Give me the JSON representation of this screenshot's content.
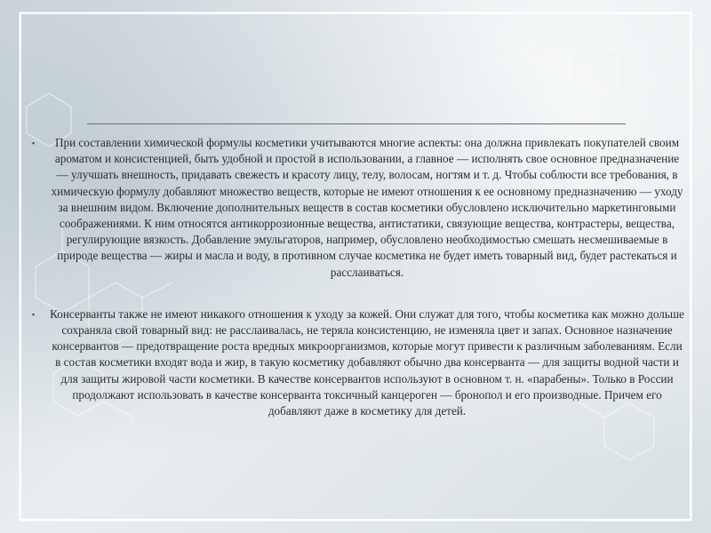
{
  "slide": {
    "bullet_glyph": "▪",
    "paragraphs": [
      "При составлении химической формулы косметики учитываются многие аспекты: она должна привлекать покупателей своим ароматом и консистенцией, быть удобной и простой в использовании, а главное — исполнять свое основное предназначение — улучшать внешность, придавать свежесть и красоту лицу, телу, волосам, ногтям и т. д. Чтобы соблюсти все требования, в химическую формулу добавляют множество веществ, которые не имеют отношения к ее основному предназначению — уходу за внешним видом. Включение дополнительных веществ в состав косметики обусловлено исключительно маркетинговыми соображениями. К ним относятся антикоррозионные вещества, антистатики, связующие вещества, контрастеры, вещества, регулирующие вязкость. Добавление эмульгаторов, например, обусловлено необходимостью смешать несмешиваемые в природе вещества — жиры и масла и воду, в противном случае косметика не будет иметь товарный вид, будет растекаться и расслаиваться.",
      "Консерванты также не имеют никакого отношения к уходу за кожей. Они служат для того, чтобы косметика как можно дольше сохраняла свой товарный вид: не расслаивалась, не теряла консистенцию, не изменяла цвет и запах. Основное назначение консервантов — предотвращение роста вредных микроорганизмов, которые могут привести к различным заболеваниям. Если в состав косметики входят вода и жир, в такую косметику добавляют обычно два консерванта — для защиты водной части и для защиты жировой части косметики. В качестве консервантов используют в основном т. н. «парабены». Только в России продолжают использовать в качестве консерванта токсичный канцероген — бронопол и его производные. Причем его добавляют даже в косметику для детей."
    ]
  },
  "colors": {
    "text": "#2d2d2d",
    "frame": "#ffffff",
    "rule": "#6f6f6f"
  }
}
